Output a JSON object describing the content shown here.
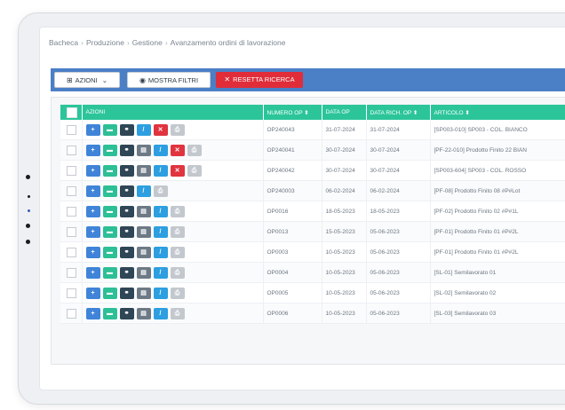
{
  "breadcrumb": [
    "Bacheca",
    "Produzione",
    "Gestione",
    "Avanzamento ordini di lavorazione"
  ],
  "toolbar": {
    "azioni_label": "AZIONI",
    "mostra_filtri_label": "MOSTRA FILTRI",
    "resetta_label": "RESETTA RICERCA"
  },
  "table": {
    "columns": [
      "AZIONI",
      "NUMERO OP",
      "DATA OP",
      "DATA RICH. OP",
      "ARTICOLO"
    ],
    "rows": [
      {
        "num": "OP240043",
        "data": "31-07-2024",
        "rich": "31-07-2024",
        "art": "[SP003-010] SP003 - COL. BIANCO",
        "actions": [
          "add",
          "fol",
          "lnk",
          "edt",
          "del",
          "prt"
        ]
      },
      {
        "num": "OP240041",
        "data": "30-07-2024",
        "rich": "30-07-2024",
        "art": "[PF-22-010] Prodotto Finito 22 BIAN",
        "actions": [
          "add",
          "fol",
          "lnk",
          "doc",
          "edt",
          "del",
          "prt"
        ]
      },
      {
        "num": "OP240042",
        "data": "30-07-2024",
        "rich": "30-07-2024",
        "art": "[SP003-604] SP003 - COL. ROSSO",
        "actions": [
          "add",
          "fol",
          "lnk",
          "doc",
          "edt",
          "del",
          "prt"
        ]
      },
      {
        "num": "OP240003",
        "data": "06-02-2024",
        "rich": "06-02-2024",
        "art": "[PF-08] Prodotto Finito 08 #P#Lot",
        "actions": [
          "add",
          "fol",
          "lnk",
          "edt",
          "prt"
        ]
      },
      {
        "num": "OP0016",
        "data": "18-05-2023",
        "rich": "18-05-2023",
        "art": "[PF-02] Prodotto Finito 02 #P#1L",
        "actions": [
          "add",
          "fol",
          "lnk",
          "doc",
          "edt",
          "prt"
        ]
      },
      {
        "num": "OP0013",
        "data": "15-05-2023",
        "rich": "05-06-2023",
        "art": "[PF-01] Prodotto Finito 01 #P#2L",
        "actions": [
          "add",
          "fol",
          "lnk",
          "doc",
          "edt",
          "prt"
        ]
      },
      {
        "num": "OP0003",
        "data": "10-05-2023",
        "rich": "05-06-2023",
        "art": "[PF-01] Prodotto Finito 01 #P#2L",
        "actions": [
          "add",
          "fol",
          "lnk",
          "doc",
          "edt",
          "prt"
        ]
      },
      {
        "num": "OP0004",
        "data": "10-05-2023",
        "rich": "05-06-2023",
        "art": "[SL-01] Semilavorato 01",
        "actions": [
          "add",
          "fol",
          "lnk",
          "doc",
          "edt",
          "prt"
        ]
      },
      {
        "num": "OP0005",
        "data": "10-05-2023",
        "rich": "05-06-2023",
        "art": "[SL-02] Semilavorato 02",
        "actions": [
          "add",
          "fol",
          "lnk",
          "doc",
          "edt",
          "prt"
        ]
      },
      {
        "num": "OP0006",
        "data": "10-05-2023",
        "rich": "05-06-2023",
        "art": "[SL-03] Semilavorato 03",
        "actions": [
          "add",
          "fol",
          "lnk",
          "doc",
          "edt",
          "prt"
        ]
      }
    ]
  },
  "icons": {
    "add": "+",
    "fol": "▬",
    "lnk": "⚭",
    "doc": "▤",
    "edt": "/",
    "del": "✕",
    "prt": "⎙"
  },
  "colors": {
    "toolbar": "#4b7fc6",
    "header": "#2cc59a",
    "reset": "#e02d39"
  }
}
